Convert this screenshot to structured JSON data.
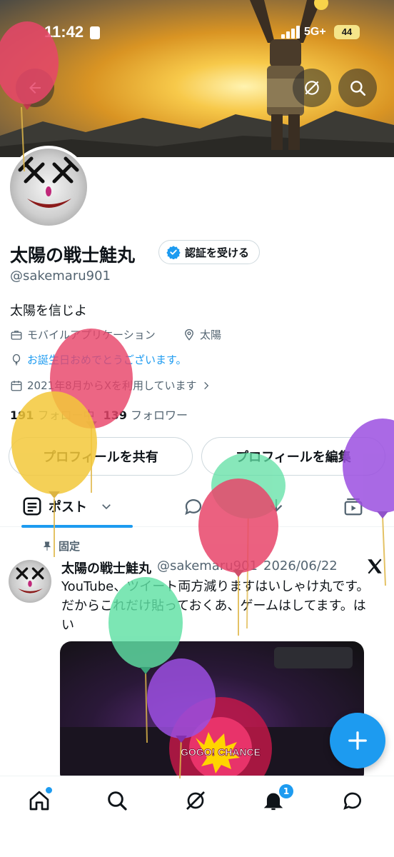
{
  "status_bar": {
    "time": "11:42",
    "network": "5G+",
    "battery": "44"
  },
  "profile": {
    "name": "太陽の戦士鮭丸",
    "verify_label": "認証を受ける",
    "handle": "@sakemaru901",
    "bio": "太陽を信じよ",
    "category": "モバイルアプリケーション",
    "location": "太陽",
    "birthday": "お誕生日おめでとうございます。",
    "joined": "2021年8月からXを利用しています",
    "following_count": "191",
    "following_label": "フォロー中",
    "followers_count": "139",
    "followers_label": "フォロワー"
  },
  "actions": {
    "share": "プロフィールを共有",
    "edit": "プロフィールを編集"
  },
  "tabs": {
    "posts_label": "ポスト"
  },
  "pinned_tweet": {
    "pinned_label": "固定",
    "author_name": "太陽の戦士鮭丸",
    "author_handle": "@sakemaru901",
    "date": "2026/06/22",
    "text": "YouTube、ツイート両方減りますはいしゃけ丸です。だからこれだけ貼っておくあ、ゲームはしてます。はい",
    "media_sign_text": "GOGO! CHANCE"
  },
  "bottom_nav": {
    "notification_badge": "1"
  },
  "colors": {
    "accent": "#1d9bf0",
    "text": "#0f1419",
    "secondary": "#536471"
  },
  "icons": [
    "back-arrow-icon",
    "grok-icon",
    "search-icon",
    "verified-badge-icon",
    "briefcase-icon",
    "location-pin-icon",
    "balloon-icon",
    "calendar-icon",
    "chevron-right-icon",
    "posts-tab-icon",
    "chevron-down-icon",
    "replies-icon",
    "highlights-icon",
    "media-icon",
    "pin-icon",
    "x-logo-icon",
    "plus-icon",
    "home-icon",
    "explore-icon",
    "notifications-icon",
    "messages-icon"
  ]
}
